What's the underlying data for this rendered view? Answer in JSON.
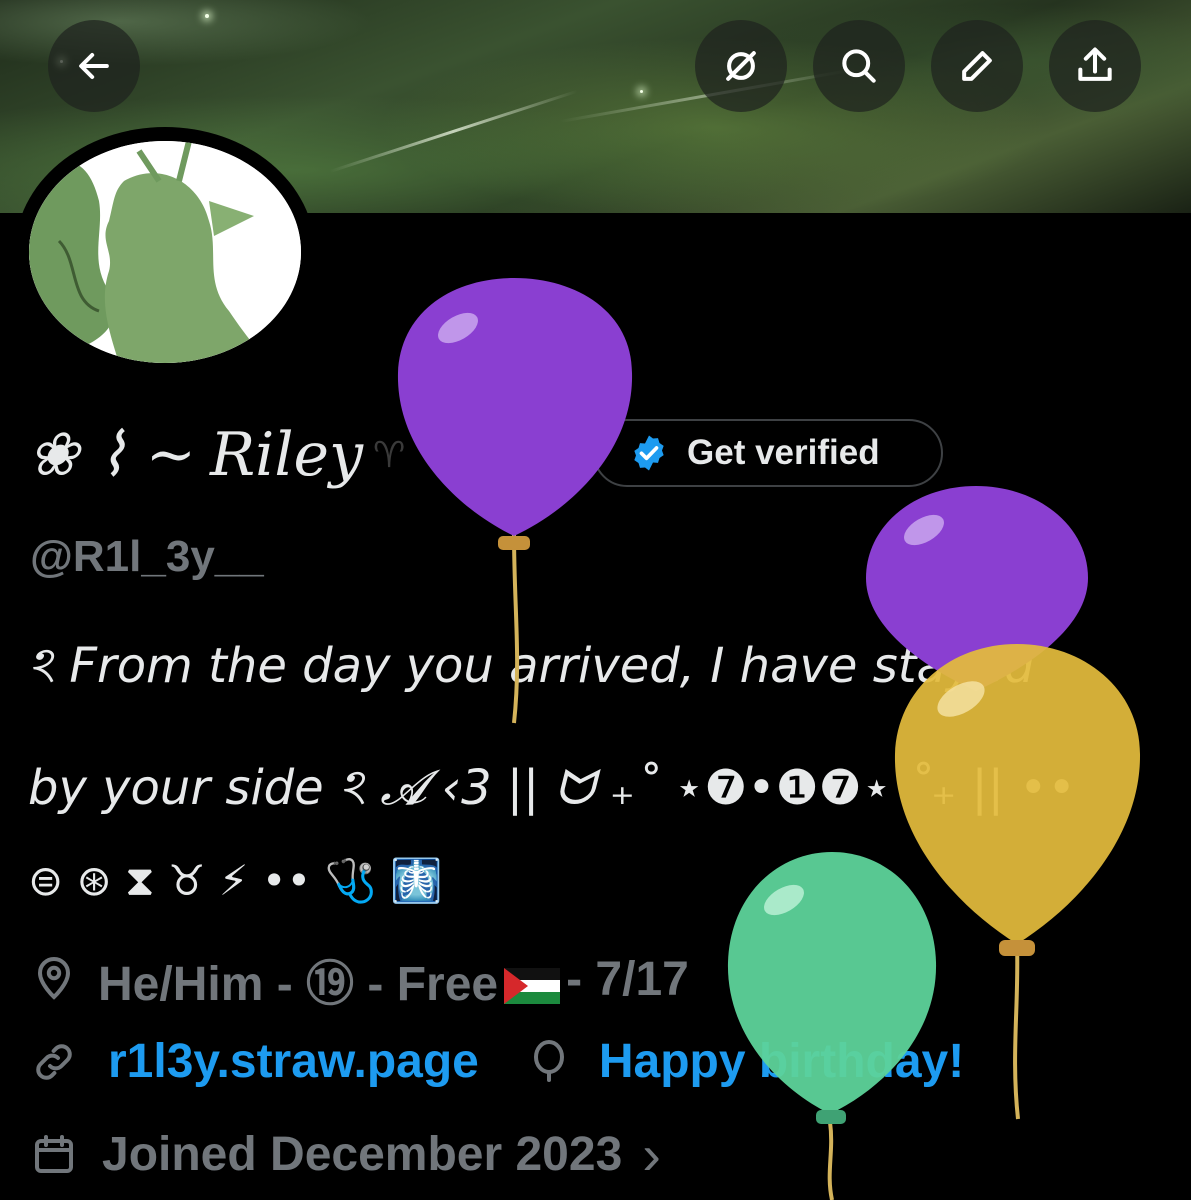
{
  "header": {
    "back_icon": "arrow-left-icon",
    "actions": [
      "mute-icon",
      "search-icon",
      "edit-icon",
      "share-icon"
    ]
  },
  "profile": {
    "name_prefix": "❀ ⌇ ~",
    "name": "Riley",
    "name_suffix": "♈",
    "verify_label": "Get verified",
    "handle": "@R1l_3y__",
    "bio_line1": "ঽ From the day you arrived, I have stayed",
    "bio_line2": "by your side ঽ 𝓐 ‹3 || ᗢ ₊˚ ⋆❼•❶❼⋆ ˚₊ || ••",
    "bio_line3": "⊜ ⊛ ⧗ ♉ ⚡ •• 🩺 🩻",
    "location": "He/Him - ⑲ - Free",
    "location_tail": "- 7/17",
    "website": "r1l3y.straw.page",
    "birthday": "Happy birthday!",
    "joined": "Joined December 2023",
    "joined_chevron": "›"
  },
  "colors": {
    "background": "#000000",
    "text": "#e7e9ea",
    "muted": "#71767b",
    "link": "#1d9bf0",
    "verified_badge": "#1d9bf0",
    "balloon_purple": "#8a3fd1",
    "balloon_yellow": "#e3bb3c",
    "balloon_green": "#5dd39a"
  }
}
